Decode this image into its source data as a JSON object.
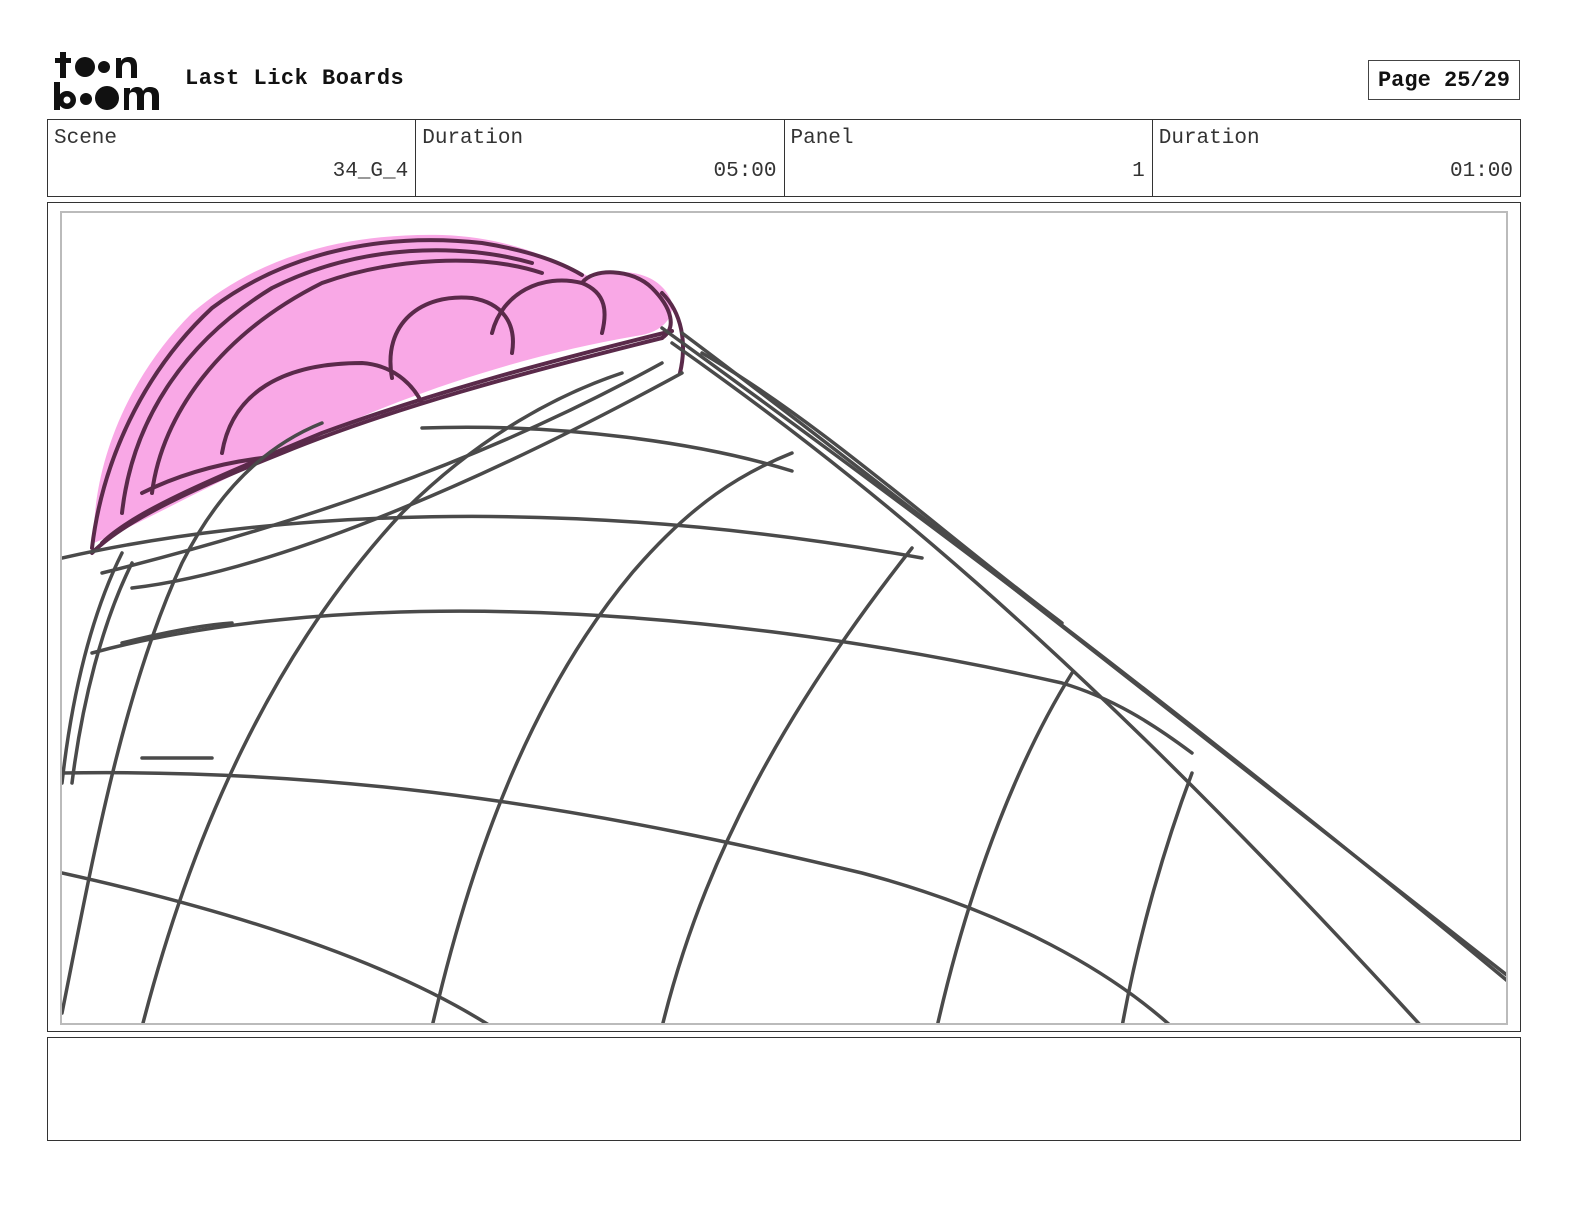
{
  "header": {
    "project_title": "Last Lick Boards",
    "page_label": "Page 25/29",
    "logo_text": "toon boom"
  },
  "info": [
    {
      "label": "Scene",
      "value": "34_G_4"
    },
    {
      "label": "Duration",
      "value": "05:00"
    },
    {
      "label": "Panel",
      "value": "1"
    },
    {
      "label": "Duration",
      "value": "01:00"
    }
  ],
  "panel": {
    "sketch_colors": {
      "line": "#4a4a4a",
      "highlight": "#f9a8e6",
      "highlight_outline": "#5a2a4a"
    }
  },
  "notes": {
    "text": ""
  }
}
